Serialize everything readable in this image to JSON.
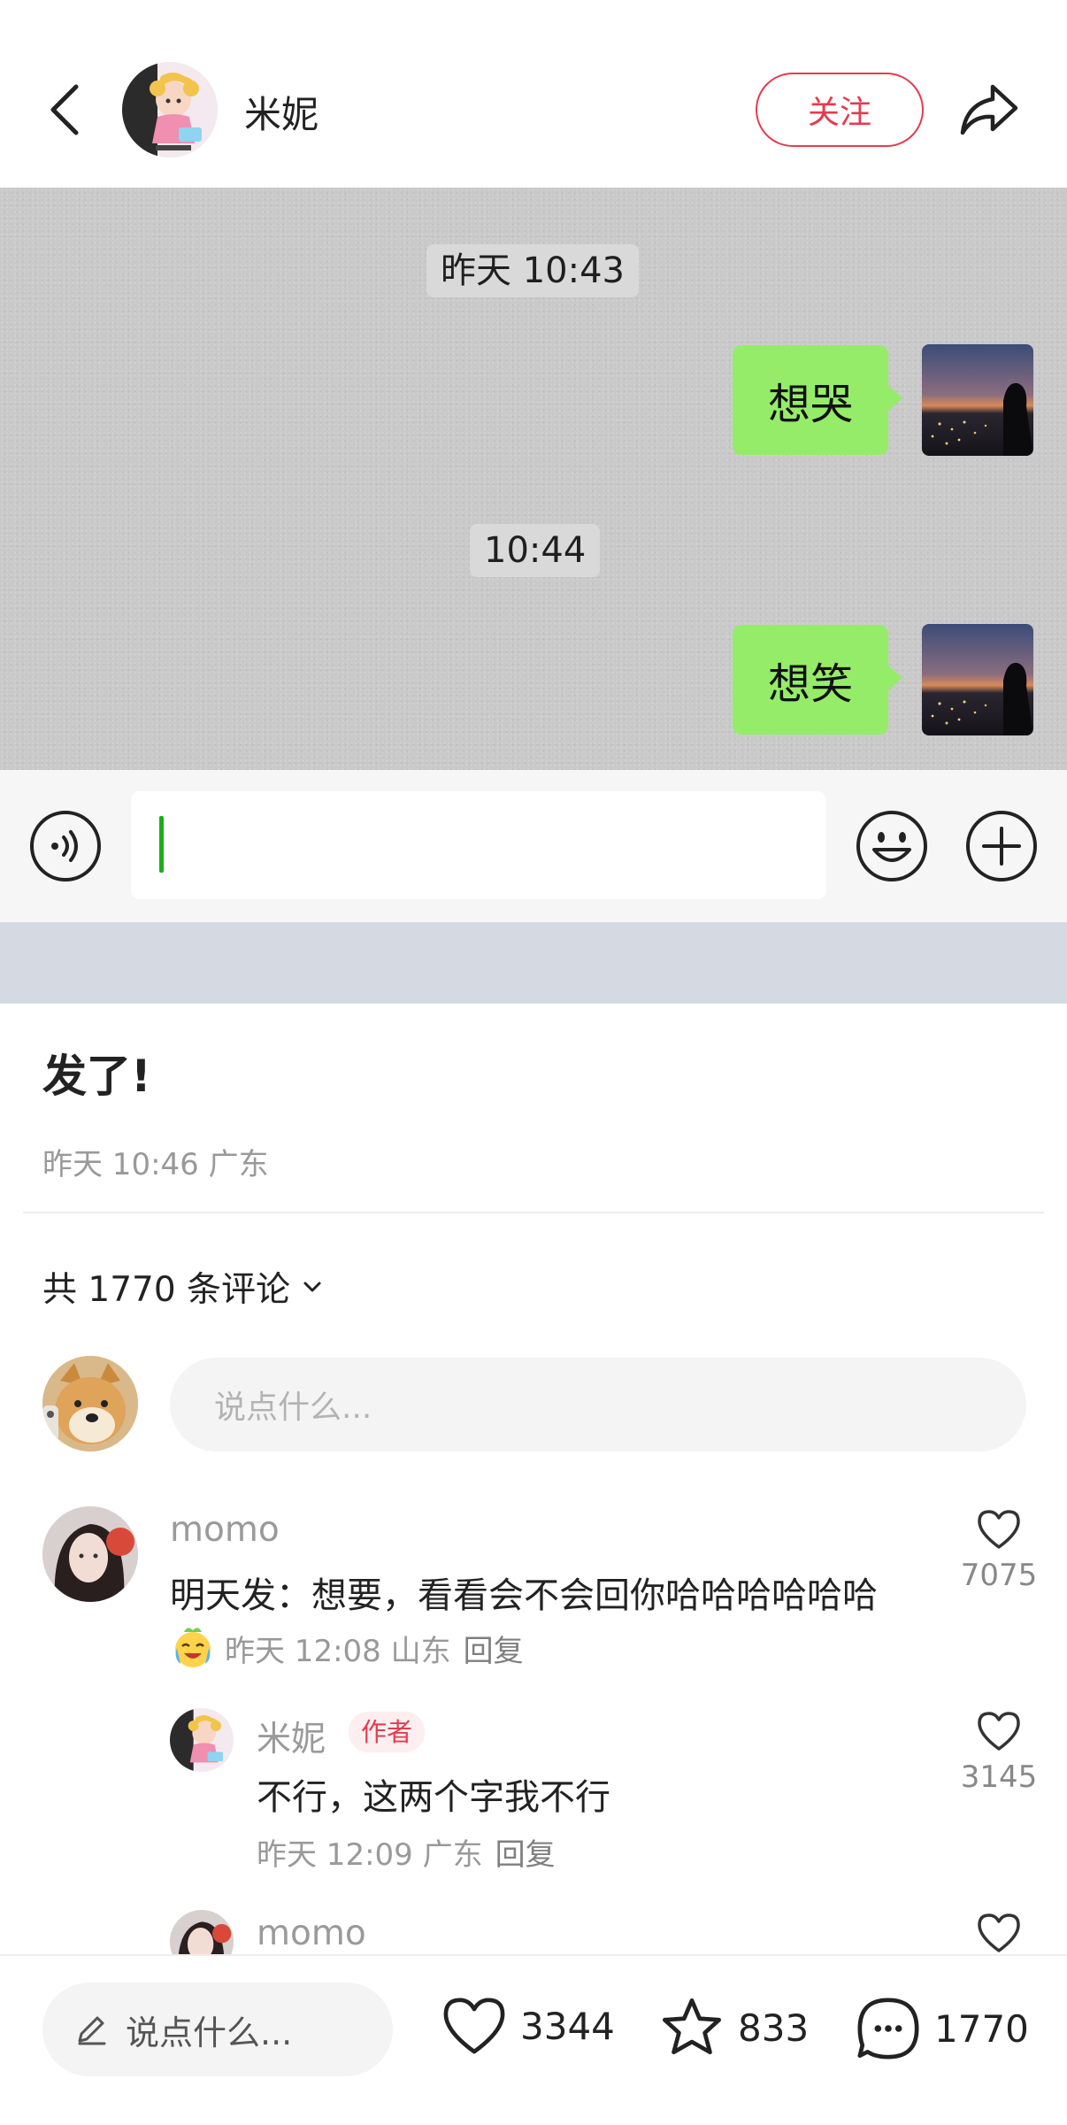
{
  "header": {
    "user_name": "米妮",
    "follow_label": "关注"
  },
  "chat_screenshot": {
    "messages": [
      {
        "time": "昨天 10:43",
        "text": "想哭"
      },
      {
        "time": "10:44",
        "text": "想笑"
      }
    ],
    "colors": {
      "bubble": "#95ec69",
      "background": "#c9c9c9"
    }
  },
  "post": {
    "title": "发了!",
    "meta": "昨天 10:46 广东"
  },
  "comments_section": {
    "count_label": "共 1770 条评论",
    "input_placeholder": "说点什么...",
    "comments": [
      {
        "user": "momo",
        "text": "明天发：想要，看看会不会回你哈哈哈哈哈哈",
        "meta": "昨天 12:08 山东",
        "reply_label": "回复",
        "likes": "7075",
        "emoji": "crying-laughing-emoji"
      },
      {
        "user": "米妮",
        "author_tag": "作者",
        "text": "不行，这两个字我不行",
        "meta": "昨天 12:09 广东",
        "reply_label": "回复",
        "likes": "3145"
      },
      {
        "user": "momo"
      }
    ]
  },
  "bottom_bar": {
    "input_placeholder": "说点什么...",
    "likes": "3344",
    "stars": "833",
    "comments": "1770"
  },
  "accent_color": "#e33c50"
}
